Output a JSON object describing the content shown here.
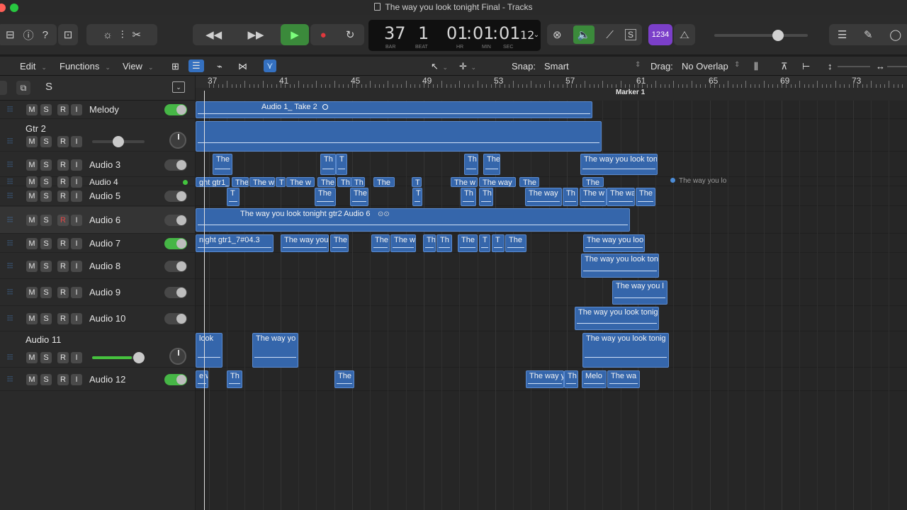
{
  "window": {
    "title": "The way you look tonight Final - Tracks"
  },
  "lcd": {
    "bar": "37",
    "beat": "1",
    "time_hr": "01",
    "time_min": "01",
    "time_sec": "01",
    "time_frac": "12",
    "bar_label": "BAR",
    "beat_label": "BEAT",
    "hr_label": "HR",
    "min_label": "MIN",
    "sec_label": "SEC"
  },
  "toolbar": {
    "count_in": "1234",
    "tempo_icon": "metronome-icon"
  },
  "menubar": {
    "edit": "Edit",
    "functions": "Functions",
    "view": "View",
    "snap_label": "Snap:",
    "snap_value": "Smart",
    "drag_label": "Drag:",
    "drag_value": "No Overlap"
  },
  "trackhead": {
    "solo": "S"
  },
  "buttons": {
    "m": "M",
    "s": "S",
    "r": "R",
    "i": "I"
  },
  "tracks": [
    {
      "name": "Melody",
      "toggle": "on"
    },
    {
      "name": "Gtr 2",
      "fader": 0.55
    },
    {
      "name": "Audio 3",
      "toggle": "off"
    },
    {
      "name": "Audio 4",
      "toggle": "dot"
    },
    {
      "name": "Audio 5",
      "toggle": "off"
    },
    {
      "name": "Audio 6",
      "toggle": "off",
      "record_armed": true
    },
    {
      "name": "Audio 7",
      "toggle": "on"
    },
    {
      "name": "Audio 8",
      "toggle": "off"
    },
    {
      "name": "Audio 9",
      "toggle": "off"
    },
    {
      "name": "Audio 10",
      "toggle": "off"
    },
    {
      "name": "Audio 11",
      "fader": 0.95
    },
    {
      "name": "Audio 12",
      "toggle": "on"
    }
  ],
  "ruler": {
    "bars": [
      "37",
      "41",
      "45",
      "49",
      "53",
      "57",
      "61",
      "65",
      "69",
      "73"
    ],
    "marker": "Marker 1"
  },
  "regions": {
    "melody": "Audio 1_ Take 2",
    "gtr2": "",
    "a3_1": "The",
    "a3_2": "Th",
    "a3_3": "T",
    "a3_4": "Th",
    "a3_5": "The",
    "a3_6": "The way you look ton",
    "a4_1": "ght gtr1_",
    "a4_2": "The",
    "a4_3": "The w",
    "a4_4": "T",
    "a4_5": "The w",
    "a4_6": "The",
    "a4_7": "Th",
    "a4_8": "Th",
    "a4_9": "The",
    "a4_10": "T",
    "a4_11": "The w",
    "a4_12": "The way",
    "a4_13": "The",
    "a4_14": "The",
    "a4_15": "The way you lo",
    "a5_1": "T",
    "a5_2": "The",
    "a5_3": "The",
    "a5_4": "T",
    "a5_5": "Th",
    "a5_6": "Th",
    "a5_7": "The way",
    "a5_8": "Th",
    "a5_9": "The w",
    "a5_10": "The wa",
    "a5_11": "The",
    "a6_1": "The way you look tonight gtr2 Audio 6",
    "a7_1": "night gtr1_7#04.3",
    "a7_2": "The way you",
    "a7_3": "The",
    "a7_4": "The",
    "a7_5": "The w",
    "a7_6": "Th",
    "a7_7": "Th",
    "a7_8": "The",
    "a7_9": "T",
    "a7_10": "T",
    "a7_11": "The",
    "a7_12": "The way you loo",
    "a8_1": "The way you look ton",
    "a9_1": "The way you l",
    "a10_1": "The way you look tonig",
    "a11_1": "look",
    "a11_2": "The way yo",
    "a11_3": "The way you look tonig",
    "a12_1": "e w",
    "a12_2": "Th",
    "a12_3": "The",
    "a12_4": "The way y",
    "a12_5": "Th",
    "a12_6": "Melo",
    "a12_7": "The wa"
  }
}
